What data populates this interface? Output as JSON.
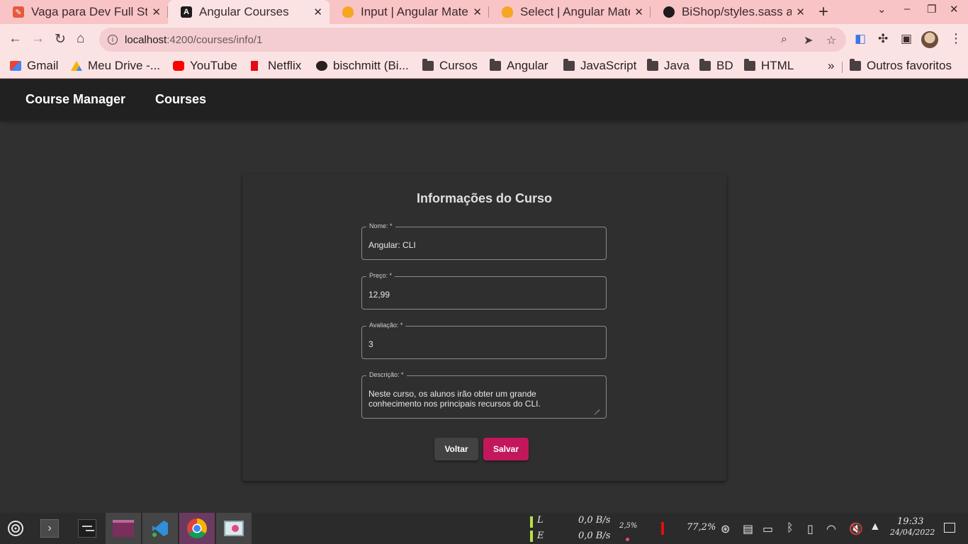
{
  "browser": {
    "tabs": [
      {
        "label": "Vaga para Dev Full Stack",
        "icon": "pencil-icon",
        "color": "#e45a3b",
        "active": false
      },
      {
        "label": "Angular Courses",
        "icon": "angular-icon",
        "color": "#1f1a1b",
        "active": true
      },
      {
        "label": "Input | Angular Material",
        "icon": "material-shield-icon",
        "color": "#f5a623",
        "active": false
      },
      {
        "label": "Select | Angular Material",
        "icon": "material-shield-icon",
        "color": "#f5a623",
        "active": false
      },
      {
        "label": "BiShop/styles.sass at",
        "icon": "github-icon",
        "color": "#1f1a1b",
        "active": false
      }
    ],
    "new_tab": "+",
    "address": {
      "host": "localhost",
      "path": ":4200/courses/info/1"
    },
    "bookmarks": [
      {
        "label": "Gmail",
        "icon": "gmail-icon"
      },
      {
        "label": "Meu Drive -...",
        "icon": "drive-icon"
      },
      {
        "label": "YouTube",
        "icon": "youtube-icon"
      },
      {
        "label": "Netflix",
        "icon": "netflix-icon"
      },
      {
        "label": "bischmitt (Bi...",
        "icon": "github-icon"
      },
      {
        "label": "Cursos",
        "icon": "folder-icon"
      },
      {
        "label": "Angular",
        "icon": "folder-icon"
      },
      {
        "label": "JavaScript",
        "icon": "folder-icon"
      },
      {
        "label": "Java",
        "icon": "folder-icon"
      },
      {
        "label": "BD",
        "icon": "folder-icon"
      },
      {
        "label": "HTML",
        "icon": "folder-icon"
      }
    ],
    "bookmarks_overflow": "»",
    "other_bookmarks": "Outros favoritos"
  },
  "app": {
    "title": "Course Manager",
    "nav": "Courses",
    "accent": "#c2185b"
  },
  "form": {
    "title": "Informações do Curso",
    "fields": {
      "name": {
        "label": "Nome: *",
        "value": "Angular: CLI"
      },
      "price": {
        "label": "Preço: *",
        "value": "12,99"
      },
      "rating": {
        "label": "Avaliação: *",
        "value": "3"
      },
      "description": {
        "label": "Descrição: *",
        "value": "Neste curso, os alunos irão obter um grande\nconhecimento nos principais recursos do CLI."
      }
    },
    "back_label": "Voltar",
    "save_label": "Salvar"
  },
  "taskbar": {
    "net_up_label": "L",
    "net_down_label": "E",
    "net_up": "0,0 B/s",
    "net_down": "0,0 B/s",
    "cpu": "2,5%",
    "battery": "77,2%",
    "time": "19:33",
    "date": "24/04/2022"
  }
}
